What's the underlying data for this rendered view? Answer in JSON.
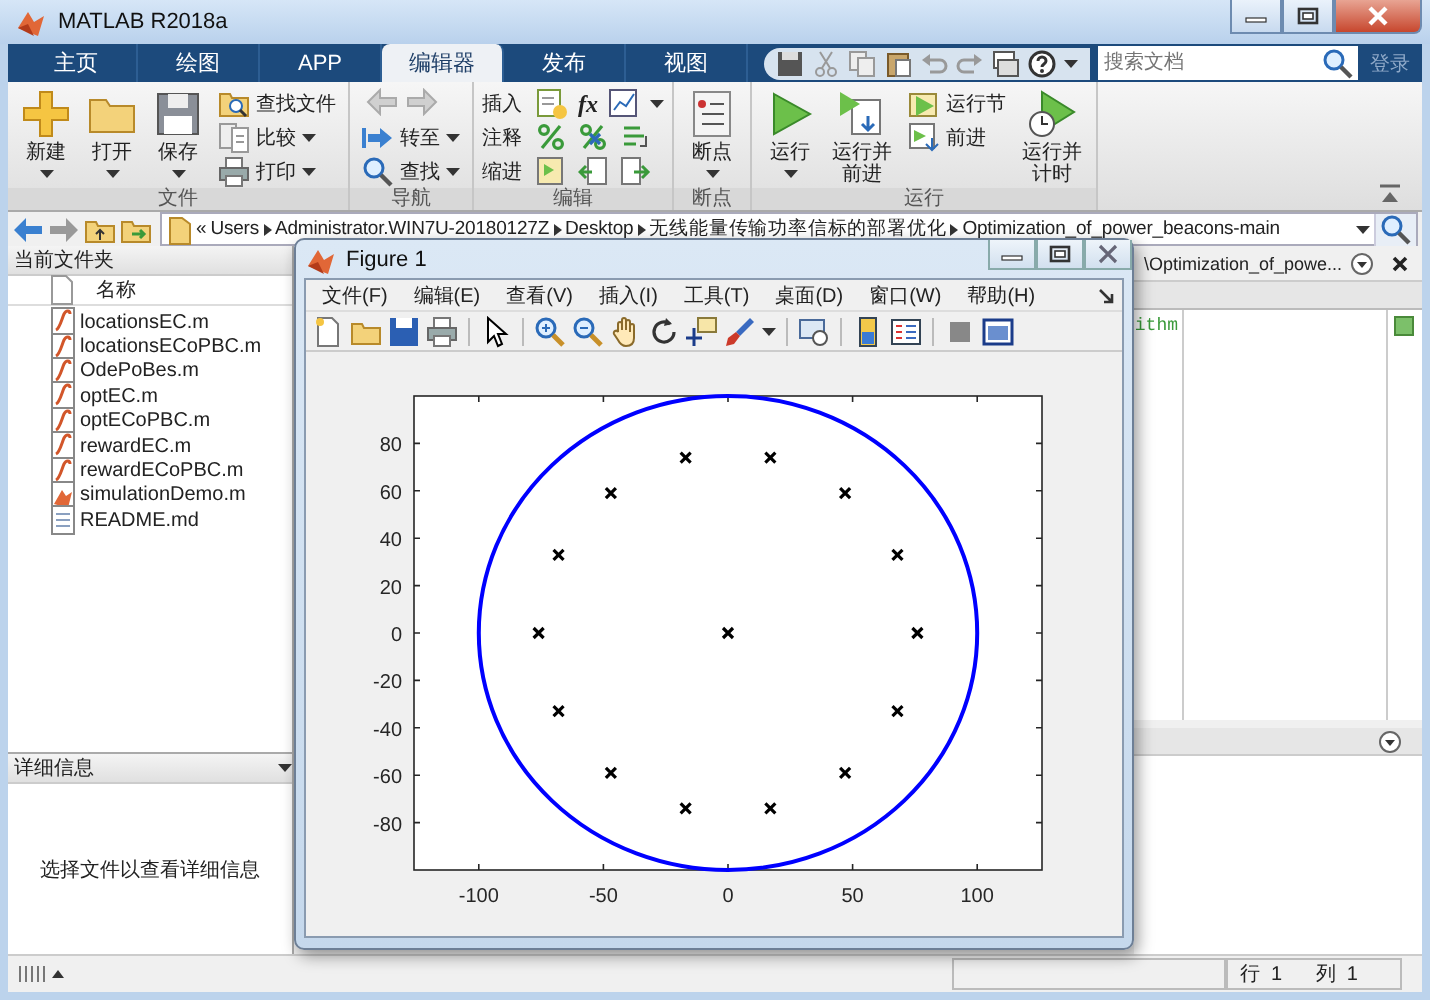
{
  "window": {
    "title": "MATLAB R2018a"
  },
  "tabs": [
    {
      "label": "主页",
      "selected": false
    },
    {
      "label": "绘图",
      "selected": false
    },
    {
      "label": "APP",
      "selected": false
    },
    {
      "label": "编辑器",
      "selected": true
    },
    {
      "label": "发布",
      "selected": false
    },
    {
      "label": "视图",
      "selected": false
    }
  ],
  "search": {
    "placeholder": "搜索文档"
  },
  "sign_in": {
    "label": "登录",
    "disabled": true
  },
  "ribbon": {
    "groups": [
      {
        "label": "文件",
        "items": [
          {
            "kind": "large",
            "label": "新建",
            "dropdown": true
          },
          {
            "kind": "large",
            "label": "打开",
            "dropdown": true
          },
          {
            "kind": "large",
            "label": "保存",
            "dropdown": true
          },
          {
            "kind": "stack",
            "items": [
              {
                "kind": "small",
                "label": "查找文件",
                "dropdown": false
              },
              {
                "kind": "small",
                "label": "比较",
                "dropdown": true
              },
              {
                "kind": "small",
                "label": "打印",
                "dropdown": true
              }
            ]
          }
        ]
      },
      {
        "label": "导航",
        "items": [
          {
            "kind": "stack",
            "items": [
              {
                "kind": "arrows",
                "disabled": true
              },
              {
                "kind": "small",
                "label": "转至",
                "dropdown": true
              },
              {
                "kind": "small",
                "label": "查找",
                "dropdown": true
              }
            ]
          }
        ]
      },
      {
        "label": "编辑",
        "items": [
          {
            "kind": "rows",
            "items": [
              {
                "label": "插入",
                "symbol": "fx",
                "dropdown": true
              },
              {
                "label": "注释",
                "dropdown": false
              },
              {
                "label": "缩进",
                "dropdown": false
              }
            ]
          }
        ]
      },
      {
        "label": "断点",
        "items": [
          {
            "kind": "large",
            "label": "断点",
            "dropdown": true
          }
        ]
      },
      {
        "label": "运行",
        "items": [
          {
            "kind": "large",
            "label": "运行",
            "dropdown": true
          },
          {
            "kind": "large",
            "label": "运行并前进"
          },
          {
            "kind": "stack",
            "items": [
              {
                "kind": "small",
                "label": "运行节",
                "dropdown": false
              },
              {
                "kind": "small",
                "label": "前进",
                "dropdown": false
              }
            ]
          },
          {
            "kind": "large",
            "label": "运行并计时"
          }
        ]
      }
    ]
  },
  "address": {
    "overflow_mark": "«",
    "segments": [
      "Users",
      "Administrator.WIN7U-20180127Z",
      "Desktop",
      "无线能量传输功率信标的部署优化",
      "Optimization_of_power_beacons-main"
    ]
  },
  "current_folder": {
    "title": "当前文件夹",
    "column": "名称",
    "files": [
      {
        "name": "locationsEC.m",
        "kind": "m"
      },
      {
        "name": "locationsECoPBC.m",
        "kind": "m"
      },
      {
        "name": "OdePoBes.m",
        "kind": "m"
      },
      {
        "name": "optEC.m",
        "kind": "m"
      },
      {
        "name": "optECoPBC.m",
        "kind": "m"
      },
      {
        "name": "rewardEC.m",
        "kind": "m"
      },
      {
        "name": "rewardECoPBC.m",
        "kind": "m"
      },
      {
        "name": "simulationDemo.m",
        "kind": "app"
      },
      {
        "name": "README.md",
        "kind": "text"
      }
    ]
  },
  "details": {
    "title": "详细信息",
    "message": "选择文件以查看详细信息"
  },
  "editor": {
    "tab_title": "\\Optimization_of_powe...",
    "code_fragment": "ithm"
  },
  "figure": {
    "title": "Figure 1",
    "menu": [
      "文件(F)",
      "编辑(E)",
      "查看(V)",
      "插入(I)",
      "工具(T)",
      "桌面(D)",
      "窗口(W)",
      "帮助(H)"
    ],
    "chart_data": {
      "type": "scatter",
      "xlim": [
        -126,
        126
      ],
      "ylim": [
        -100,
        100
      ],
      "xticks": [
        -100,
        -50,
        0,
        50,
        100
      ],
      "yticks": [
        -80,
        -60,
        -40,
        -20,
        0,
        20,
        40,
        60,
        80
      ],
      "x": [
        0,
        76,
        68,
        47,
        17,
        -17,
        -47,
        -68,
        -76,
        -68,
        -47,
        -17,
        17,
        47,
        68
      ],
      "series": [
        {
          "color": "#000000",
          "values": [
            0,
            0,
            33,
            59,
            74,
            74,
            59,
            33,
            0,
            -33,
            -59,
            -74,
            -74,
            -59,
            -33
          ]
        }
      ]
    }
  },
  "status_bar": {
    "row_label": "行",
    "row": "1",
    "col_label": "列",
    "col": "1"
  }
}
